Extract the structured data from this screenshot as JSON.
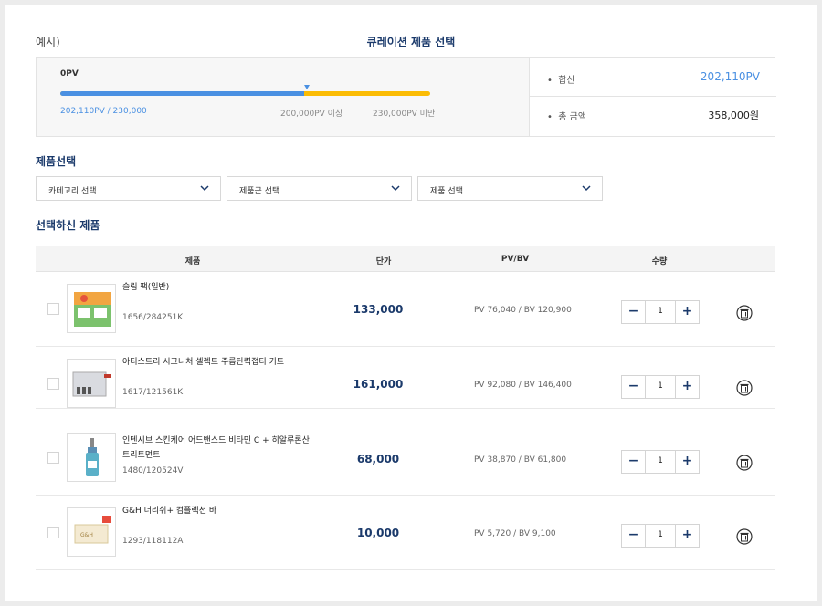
{
  "header": {
    "example_label": "예시)",
    "title": "큐레이션 제품 선택"
  },
  "pv_summary": {
    "pv_label": "0PV",
    "current": "202,110PV / 230,000",
    "threshold_low": "200,000PV 이상",
    "threshold_high": "230,000PV 미만",
    "progress_fraction": 0.66,
    "total_label": "합산",
    "total_value": "202,110PV",
    "amount_label": "총 금액",
    "amount_value": "358,000원"
  },
  "select_section": {
    "title": "제품선택",
    "category": "카테고리 선택",
    "group": "제품군 선택",
    "product": "제품 선택"
  },
  "selected_section": {
    "title": "선택하신 제품"
  },
  "table": {
    "headers": {
      "product": "제품",
      "price": "단가",
      "pvbv": "PV/BV",
      "qty": "수량"
    },
    "rows": [
      {
        "name": "슬림 팩(일반)",
        "code": "1656/284251K",
        "price": "133,000",
        "pvbv": "PV 76,040 / BV 120,900",
        "qty": "1"
      },
      {
        "name": "아티스트리 시그니처 셀렉트 주름탄력접티 키트",
        "code": "1617/121561K",
        "price": "161,000",
        "pvbv": "PV 92,080 / BV 146,400",
        "qty": "1"
      },
      {
        "name": "인텐시브 스킨케어 어드밴스드 비타민 C + 히알루론산 트리트먼트",
        "code": "1480/120524V",
        "price": "68,000",
        "pvbv": "PV 38,870 / BV 61,800",
        "qty": "1"
      },
      {
        "name": "G&H 너리쉬+ 컴플렉션 바",
        "code": "1293/118112A",
        "price": "10,000",
        "pvbv": "PV 5,720 / BV 9,100",
        "qty": "1"
      }
    ],
    "minus": "−",
    "plus": "+"
  },
  "colors": {
    "accent": "#4a90e2",
    "navy": "#1b3a6b",
    "yellow": "#fbbc05"
  }
}
